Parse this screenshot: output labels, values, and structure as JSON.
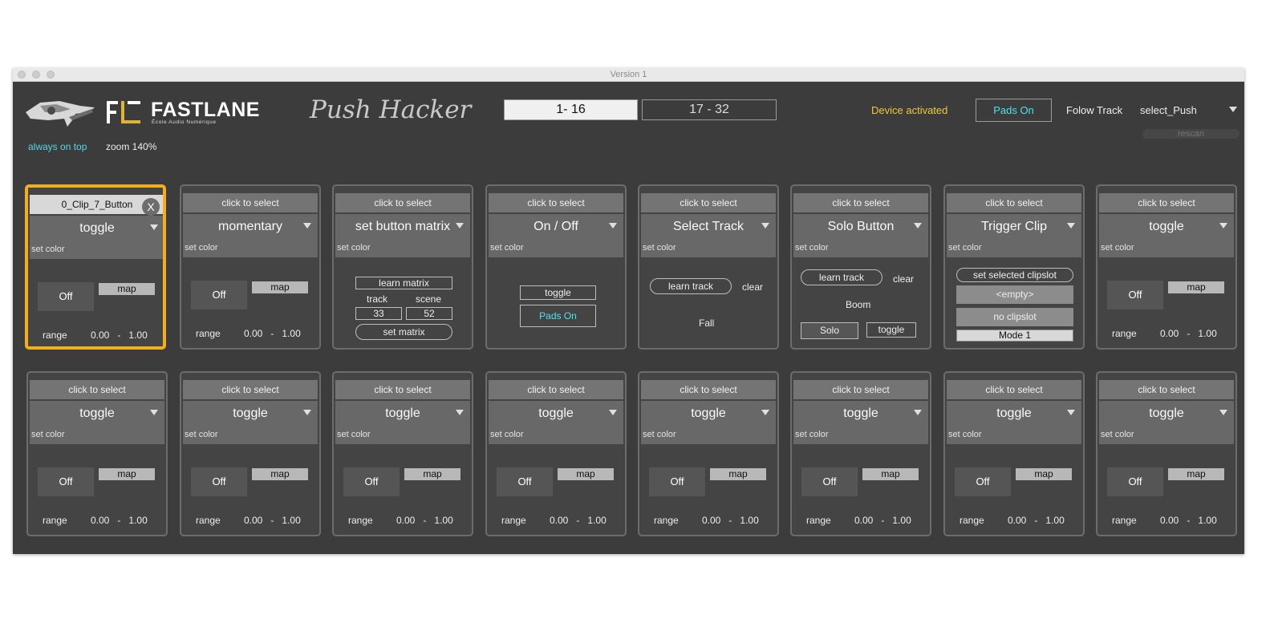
{
  "window": {
    "title": "Version 1"
  },
  "header": {
    "brand": "FASTLANE",
    "brand_sub": "École Audio Numérique",
    "product": "Push Hacker",
    "page_tabs": [
      "1- 16",
      "17 - 32"
    ],
    "device_status": "Device activated",
    "pads_button": "Pads On",
    "follow_label": "Folow Track",
    "follow_value": "select_Push",
    "rescan": "rescan",
    "always_on_top": "always on top",
    "zoom": "zoom 140%"
  },
  "colors": {
    "accent_selected": "#f1ae1f",
    "cyan": "#4fe0ee",
    "status_yellow": "#f0c93a"
  },
  "slot_common": {
    "set_color": "set color",
    "off": "Off",
    "map": "map",
    "range_label": "range",
    "range_min": "0.00",
    "range_sep": "-",
    "range_max": "1.00",
    "click_to_select": "click to select"
  },
  "slots": [
    {
      "header": "0_Clip_7_Button",
      "close": "X",
      "mode": "toggle"
    },
    {
      "header": "click to select",
      "mode": "momentary"
    },
    {
      "header": "click to select",
      "mode": "set button matrix",
      "learn_matrix": "learn matrix",
      "track_label": "track",
      "scene_label": "scene",
      "track_value": "33",
      "scene_value": "52",
      "set_matrix": "set matrix"
    },
    {
      "header": "click to select",
      "mode": "On / Off",
      "toggle": "toggle",
      "pads_on": "Pads On"
    },
    {
      "header": "click to select",
      "mode": "Select Track",
      "learn_track": "learn  track",
      "clear": "clear",
      "track_name": "Fall"
    },
    {
      "header": "click to select",
      "mode": "Solo Button",
      "learn_track": "learn  track",
      "clear": "clear",
      "track_name": "Boom",
      "solo": "Solo",
      "toggle": "toggle"
    },
    {
      "header": "click to select",
      "mode": "Trigger Clip",
      "set_selected": "set selected clipslot",
      "empty": "<empty>",
      "no_clipslot": "no clipslot",
      "mode_menu": "Mode 1"
    },
    {
      "header": "click to select",
      "mode": "toggle"
    },
    {
      "header": "click to select",
      "mode": "toggle"
    },
    {
      "header": "click to select",
      "mode": "toggle"
    },
    {
      "header": "click to select",
      "mode": "toggle"
    },
    {
      "header": "click to select",
      "mode": "toggle"
    },
    {
      "header": "click to select",
      "mode": "toggle"
    },
    {
      "header": "click to select",
      "mode": "toggle"
    },
    {
      "header": "click to select",
      "mode": "toggle"
    },
    {
      "header": "click to select",
      "mode": "toggle"
    }
  ]
}
